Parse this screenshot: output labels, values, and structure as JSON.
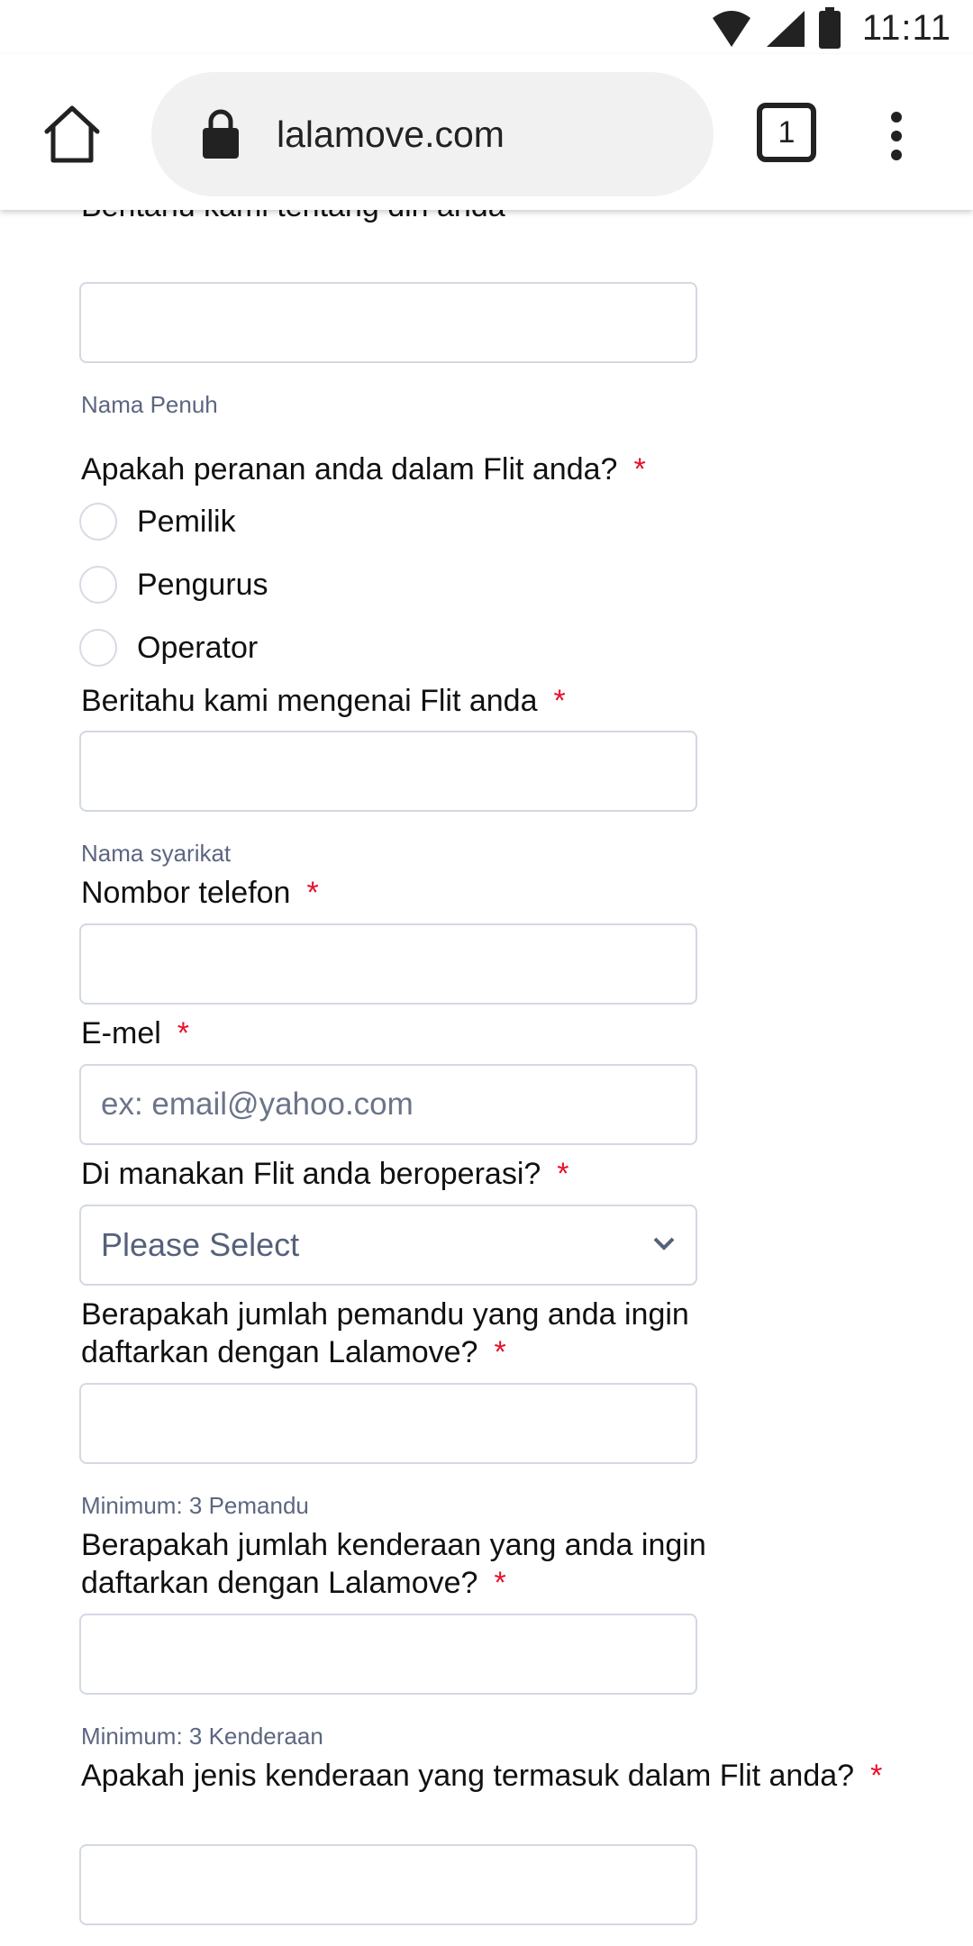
{
  "status_bar": {
    "time": "11:11",
    "icons": [
      "wifi-icon",
      "cellular-signal-icon",
      "battery-icon"
    ]
  },
  "browser": {
    "url": "lalamove.com",
    "tab_count": "1",
    "icons": [
      "home-icon",
      "lock-icon",
      "tab-switcher-icon",
      "overflow-menu-icon"
    ]
  },
  "form": {
    "required_mark": "*",
    "full_name": {
      "label": "Beritahu kami tentang diri anda",
      "value": "",
      "hint": "Nama Penuh"
    },
    "role": {
      "label": "Apakah peranan anda dalam Flit anda?",
      "options": [
        "Pemilik",
        "Pengurus",
        "Operator"
      ],
      "selected": null
    },
    "company": {
      "label": "Beritahu kami mengenai Flit anda",
      "value": "",
      "hint": "Nama syarikat"
    },
    "phone": {
      "label": "Nombor telefon",
      "value": ""
    },
    "email": {
      "label": "E-mel",
      "value": "",
      "placeholder": "ex: email@yahoo.com"
    },
    "location": {
      "label": "Di manakan Flit anda beroperasi?",
      "selected": "Please Select"
    },
    "drivers": {
      "label": "Berapakah jumlah pemandu yang anda ingin daftarkan dengan Lalamove?",
      "value": "",
      "hint": "Minimum: 3 Pemandu"
    },
    "vehicles": {
      "label": "Berapakah jumlah kenderaan yang anda ingin daftarkan dengan Lalamove?",
      "value": "",
      "hint": "Minimum: 3 Kenderaan"
    },
    "vehicle_types": {
      "label": "Apakah jenis kenderaan yang termasuk dalam Flit anda?",
      "value": ""
    }
  },
  "colors": {
    "required": "#e8102a",
    "hint_text": "#5c6680",
    "field_border": "#d3d8e2",
    "omnibox_bg": "#f1f1f1"
  }
}
